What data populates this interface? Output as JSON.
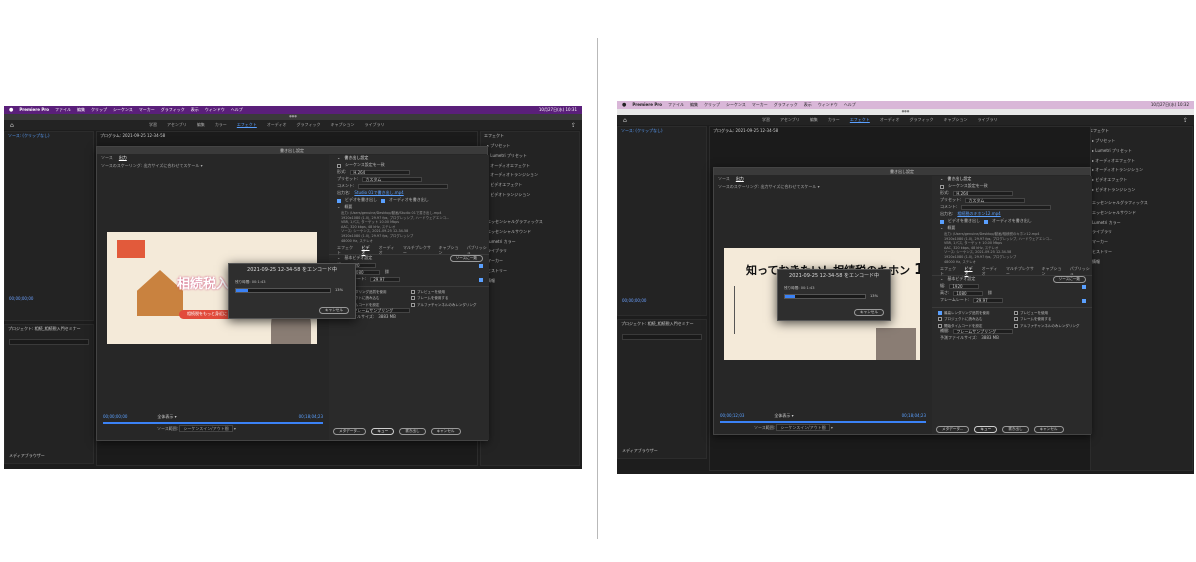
{
  "left": {
    "menubar": {
      "app": "Premiere Pro",
      "items": [
        "ファイル",
        "編集",
        "クリップ",
        "シーケンス",
        "マーカー",
        "グラフィック",
        "表示",
        "ウィンドウ",
        "ヘルプ"
      ],
      "clock": "10月27日(水) 10:31"
    },
    "workspaces": [
      "学習",
      "アセンブリ",
      "編集",
      "カラー",
      "エフェクト",
      "オーディオ",
      "グラフィック",
      "キャプション",
      "ライブラリ"
    ],
    "active_workspace": "エフェクト",
    "source_tab": "ソース: (クリップなし)",
    "program_tab": "プログラム: 2021-09-25 12-34-58",
    "effects_title": "エフェクト",
    "effects_items": [
      "プリセット",
      "Lumetri プリセット",
      "オーディオエフェクト",
      "オーディオトランジション",
      "ビデオエフェクト",
      "ビデオトランジション"
    ],
    "right_lower_items": [
      "エッセンシャルグラフィックス",
      "エッセンシャルサウンド",
      "Lumetri カラー",
      "ライブラリ",
      "マーカー",
      "ヒストリー",
      "情報"
    ],
    "export": {
      "title": "書き出し設定",
      "tabs": [
        "ソース",
        "出力"
      ],
      "source_scaling_label": "ソースのスケーリング:",
      "source_scaling_value": "出力サイズに合わせてスケール",
      "section": "書き出し設定",
      "match_sequence": "シーケンス設定を一致",
      "format_label": "形式:",
      "format_value": "H.264",
      "preset_label": "プリセット:",
      "preset_value": "カスタム",
      "comment_label": "コメント:",
      "output_label": "出力名:",
      "output_value": "Studio 01で書き出し.mp4",
      "export_video": "ビデオを書き出し",
      "export_audio": "オーディオを書き出し",
      "summary_title": "概要",
      "summary_lines": [
        "出力: /Users/genuine/Desktop/動画/Studio 01で書き出し.mp4",
        "1920x1080 (1.0), 29.97 fps, プログレッシブ, ハードウェアエンコ...",
        "VBR, 1パス, ターゲット 10.00 Mbps",
        "AAC, 320 kbps, 48 kHz, ステレオ",
        "ソース: シーケンス, 2021-09-25 12-34-58",
        "1920x1080 (1.0), 29.97 fps, プログレッシブ",
        "48000 Hz, ステレオ"
      ],
      "settings_tabs": [
        "エフェクト",
        "ビデオ",
        "オーディオ",
        "マルチプレクサー",
        "キャプション",
        "パブリッシュ"
      ],
      "active_settings_tab": "ビデオ",
      "basic_video": "基本ビデオ設定",
      "match_source": "ソースに一致",
      "width_label": "幅:",
      "width_value": "1920",
      "height_label": "高さ:",
      "height_value": "1080",
      "framerate_label": "フレームレート:",
      "framerate_value": "29.97",
      "checks": [
        "最高レンダリング品質を使用",
        "プレビューを使用",
        "プロジェクトに読み込む",
        "フレームを使用する",
        "開始タイムコードを設定",
        "アルファチャンネルのみレンダリング"
      ],
      "interp_label": "補間:",
      "interp_value": "フレームサンプリング",
      "filesize_label": "予測ファイルサイズ:",
      "filesize_value": "3883 MB",
      "buttons": [
        "メタデータ...",
        "キュー",
        "書き出し",
        "キャンセル"
      ],
      "timecode_in": "00;00;00;00",
      "timecode_out": "00;18;04;23",
      "fit_label": "全体表示",
      "source_range_label": "ソース範囲:",
      "source_range_value": "シーケンスイン/アウト間"
    },
    "encoding": {
      "title": "2021-09-25 12-34-58 をエンコード中",
      "label": "残り時間: 00:1:43",
      "percent": "13%",
      "progress": 0.13,
      "cancel": "キャンセル"
    },
    "preview_text": "相続税入門",
    "preview_sub": "相続税をもっと身近に",
    "media_browser": "メディアブラウザー",
    "project_label": "プロジェクト: 相続_相続税入門セミナー",
    "timecode": "00;00;00;00"
  },
  "right": {
    "menubar": {
      "app": "Premiere Pro",
      "items": [
        "ファイル",
        "編集",
        "クリップ",
        "シーケンス",
        "マーカー",
        "グラフィック",
        "表示",
        "ウィンドウ",
        "ヘルプ"
      ],
      "clock": "10月27日(水) 10:32"
    },
    "workspaces": [
      "学習",
      "アセンブリ",
      "編集",
      "カラー",
      "エフェクト",
      "オーディオ",
      "グラフィック",
      "キャプション",
      "ライブラリ"
    ],
    "active_workspace": "エフェクト",
    "source_tab": "ソース: (クリップなし)",
    "program_tab": "プログラム: 2021-09-25 12-34-58",
    "effects_title": "エフェクト",
    "effects_items": [
      "プリセット",
      "Lumetri プリセット",
      "オーディオエフェクト",
      "オーディオトランジション",
      "ビデオエフェクト",
      "ビデオトランジション"
    ],
    "right_lower_items": [
      "エッセンシャルグラフィックス",
      "エッセンシャルサウンド",
      "Lumetri カラー",
      "ライブラリ",
      "マーカー",
      "ヒストリー",
      "情報"
    ],
    "export": {
      "title": "書き出し設定",
      "tabs": [
        "ソース",
        "出力"
      ],
      "source_scaling_label": "ソースのスケーリング:",
      "source_scaling_value": "出力サイズに合わせてスケール",
      "section": "書き出し設定",
      "match_sequence": "シーケンス設定を一致",
      "format_label": "形式:",
      "format_value": "H.264",
      "preset_label": "プリセット:",
      "preset_value": "カスタム",
      "comment_label": "コメント:",
      "output_label": "出力名:",
      "output_value": "相続税のキホン12.mp4",
      "export_video": "ビデオを書き出し",
      "export_audio": "オーディオを書き出し",
      "summary_title": "概要",
      "summary_lines": [
        "出力: /Users/genuine/Desktop/動画/相続税のキホン12.mp4",
        "1920x1080 (1.0), 29.97 fps, プログレッシブ, ハードウェアエンコ...",
        "VBR, 1パス, ターゲット 10.00 Mbps",
        "AAC, 320 kbps, 48 kHz, ステレオ",
        "ソース: シーケンス, 2021-09-25 12-34-58",
        "1920x1080 (1.0), 29.97 fps, プログレッシブ",
        "48000 Hz, ステレオ"
      ],
      "settings_tabs": [
        "エフェクト",
        "ビデオ",
        "オーディオ",
        "マルチプレクサー",
        "キャプション",
        "パブリッシュ"
      ],
      "active_settings_tab": "ビデオ",
      "basic_video": "基本ビデオ設定",
      "match_source": "ソースに一致",
      "width_label": "幅:",
      "width_value": "1920",
      "height_label": "高さ:",
      "height_value": "1080",
      "framerate_label": "フレームレート:",
      "framerate_value": "29.97",
      "checks": [
        "最高レンダリング品質を使用",
        "プレビューを使用",
        "プロジェクトに読み込む",
        "フレームを使用する",
        "開始タイムコードを設定",
        "アルファチャンネルのみレンダリング"
      ],
      "interp_label": "補間:",
      "interp_value": "フレームサンプリング",
      "filesize_label": "予測ファイルサイズ:",
      "filesize_value": "3883 MB",
      "buttons": [
        "メタデータ...",
        "キュー",
        "書き出し",
        "キャンセル"
      ],
      "timecode_in": "00;00;12;03",
      "timecode_out": "00;18;04;23",
      "fit_label": "全体表示",
      "source_range_label": "ソース範囲:",
      "source_range_value": "シーケンスイン/アウト間"
    },
    "encoding": {
      "title": "2021-09-25 12-34-58 をエンコード中",
      "label": "残り時間: 00:1:43",
      "percent": "13%",
      "progress": 0.13,
      "cancel": "キャンセル"
    },
    "preview_title": "知っておきたい！相続税のキホン",
    "preview_number": "12",
    "preview_sub": "2021-09-25 12-34-58 をエンコード中",
    "media_browser": "メディアブラウザー",
    "project_label": "プロジェクト: 相続_相続税入門セミナー",
    "timecode": "00;00;00;00"
  }
}
